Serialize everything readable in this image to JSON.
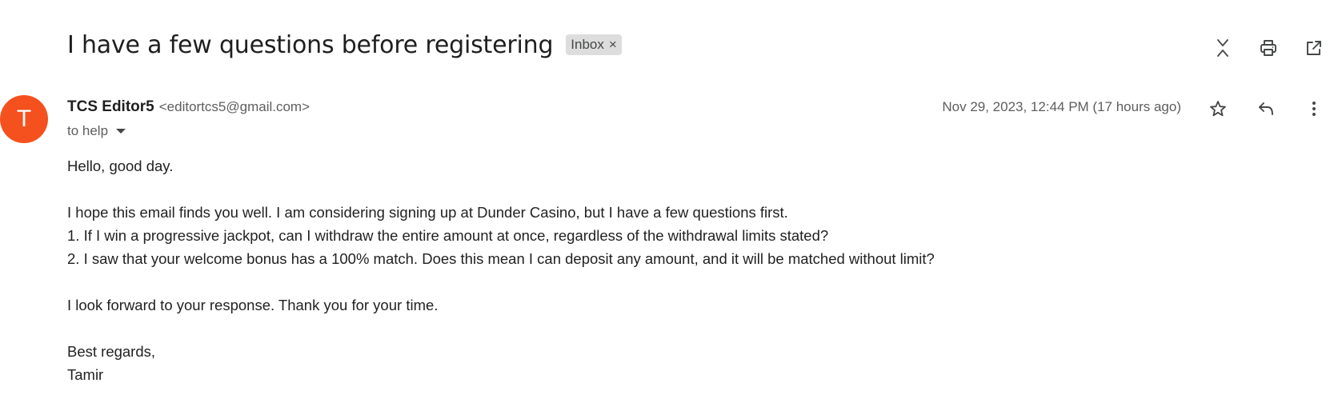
{
  "subject": {
    "title": "I have a few questions before registering",
    "label": "Inbox",
    "label_close": "×"
  },
  "toolbar": {
    "icons": [
      "collapse-all-icon",
      "print-icon",
      "open-in-new-window-icon"
    ]
  },
  "sender": {
    "avatar_initial": "T",
    "avatar_color": "#f4511e",
    "name": "TCS Editor5",
    "email": "<editortcs5@gmail.com>"
  },
  "recipient": {
    "text": "to help"
  },
  "timestamp": "Nov 29, 2023, 12:44 PM (17 hours ago)",
  "message_actions": {
    "icons": [
      "star-icon",
      "reply-icon",
      "more-vert-icon"
    ]
  },
  "body": {
    "greeting": "Hello, good day.",
    "intro": "I hope this email finds you well. I am considering signing up at Dunder Casino, but I have a few questions first.",
    "question_1": "1. If I win a progressive jackpot, can I withdraw the entire amount at once, regardless of the withdrawal limits stated?",
    "question_2": "2. I saw that your welcome bonus has a 100% match. Does this mean I can deposit any amount, and it will be matched without limit?",
    "closing": "I look forward to your response. Thank you for your time.",
    "signoff": "Best regards,",
    "signature": "Tamir"
  }
}
